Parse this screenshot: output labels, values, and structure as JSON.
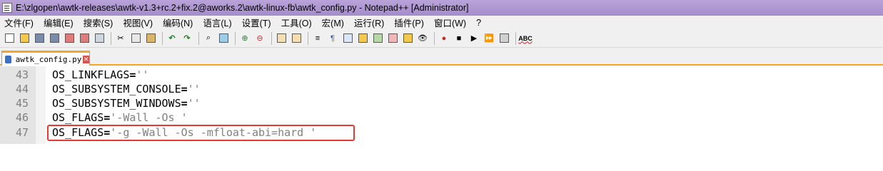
{
  "window": {
    "title": "E:\\zlgopen\\awtk-releases\\awtk-v1.3+rc.2+fix.2@aworks.2\\awtk-linux-fb\\awtk_config.py - Notepad++ [Administrator]"
  },
  "menubar": [
    "文件(F)",
    "编辑(E)",
    "搜索(S)",
    "视图(V)",
    "编码(N)",
    "语言(L)",
    "设置(T)",
    "工具(O)",
    "宏(M)",
    "运行(R)",
    "插件(P)",
    "窗口(W)",
    "?"
  ],
  "tab": {
    "label": "awtk_config.py"
  },
  "lines": [
    {
      "num": "43",
      "ident": "OS_LINKFLAGS",
      "op": "=",
      "str": "''"
    },
    {
      "num": "44",
      "ident": "OS_SUBSYSTEM_CONSOLE",
      "op": "=",
      "str": "''"
    },
    {
      "num": "45",
      "ident": "OS_SUBSYSTEM_WINDOWS",
      "op": "=",
      "str": "''"
    },
    {
      "num": "46",
      "ident": "OS_FLAGS",
      "op": "=",
      "str": "'-Wall -Os '"
    },
    {
      "num": "47",
      "ident": "OS_FLAGS",
      "op": "=",
      "str": "'-g -Wall -Os -mfloat-abi=hard '"
    }
  ],
  "colors": {
    "highlight": "#e53935",
    "tab_accent": "#f5a623",
    "titlebar": "#a58ccb"
  }
}
